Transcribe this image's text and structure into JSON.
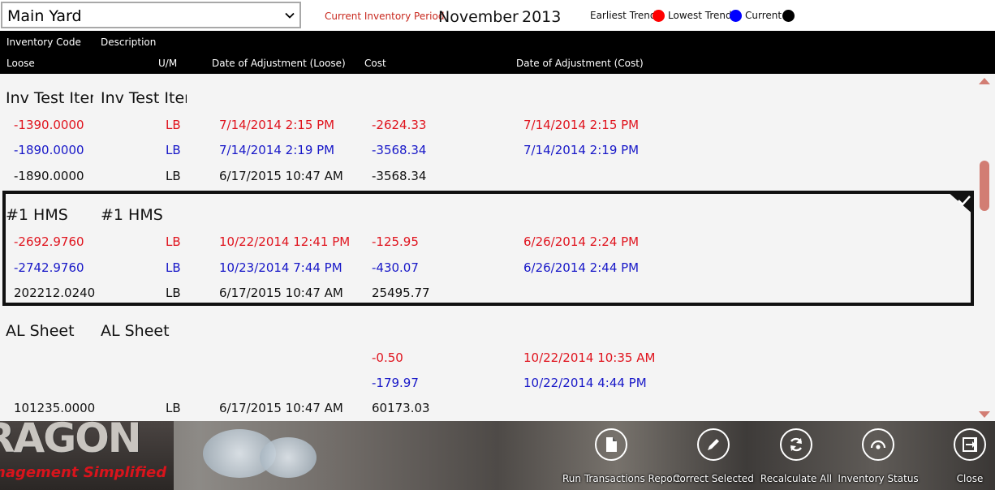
{
  "top": {
    "yard_selected": "Main Yard",
    "period_label": "Current Inventory Period",
    "period_month": "November",
    "period_year": "2013",
    "legend": [
      {
        "label": "Earliest Trend",
        "color": "#ff0000"
      },
      {
        "label": "Lowest Trend",
        "color": "#0000ff"
      },
      {
        "label": "Current",
        "color": "#000000"
      }
    ]
  },
  "header": {
    "inventory_code": "Inventory Code",
    "description": "Description",
    "loose": "Loose",
    "um": "U/M",
    "date_adj_loose": "Date of Adjustment (Loose)",
    "cost": "Cost",
    "date_adj_cost": "Date of Adjustment (Cost)"
  },
  "items": [
    {
      "code": "Inv Test Item",
      "description": "Inv Test Item",
      "earliest": {
        "loose": "-1390.0000",
        "um": "LB",
        "date_loose": "7/14/2014 2:15 PM",
        "cost": "-2624.33",
        "date_cost": "7/14/2014 2:15 PM"
      },
      "lowest": {
        "loose": "-1890.0000",
        "um": "LB",
        "date_loose": "7/14/2014 2:19 PM",
        "cost": "-3568.34",
        "date_cost": "7/14/2014 2:19 PM"
      },
      "current": {
        "loose": "-1890.0000",
        "um": "LB",
        "date_loose": "6/17/2015 10:47 AM",
        "cost": "-3568.34",
        "date_cost": ""
      }
    },
    {
      "code": "#1 HMS",
      "description": "#1 HMS",
      "earliest": {
        "loose": "-2692.9760",
        "um": "LB",
        "date_loose": "10/22/2014 12:41 PM",
        "cost": "-125.95",
        "date_cost": "6/26/2014 2:24 PM"
      },
      "lowest": {
        "loose": "-2742.9760",
        "um": "LB",
        "date_loose": "10/23/2014 7:44 PM",
        "cost": "-430.07",
        "date_cost": "6/26/2014 2:44 PM"
      },
      "current": {
        "loose": "202212.0240",
        "um": "LB",
        "date_loose": "6/17/2015 10:47 AM",
        "cost": "25495.77",
        "date_cost": ""
      }
    },
    {
      "code": "AL Sheet",
      "description": "AL Sheet",
      "earliest": {
        "loose": "",
        "um": "",
        "date_loose": "",
        "cost": "-0.50",
        "date_cost": "10/22/2014 10:35 AM"
      },
      "lowest": {
        "loose": "",
        "um": "",
        "date_loose": "",
        "cost": "-179.97",
        "date_cost": "10/22/2014 4:44 PM"
      },
      "current": {
        "loose": "101235.0000",
        "um": "LB",
        "date_loose": "6/17/2015 10:47 AM",
        "cost": "60173.03",
        "date_cost": ""
      }
    }
  ],
  "logo": {
    "main": "RAGON",
    "sub": "nagement Simplified"
  },
  "appbar": [
    {
      "label": "Run Transactions Report",
      "icon": "document-icon"
    },
    {
      "label": "Correct Selected",
      "icon": "pencil-icon"
    },
    {
      "label": "Recalculate All",
      "icon": "refresh-icon"
    },
    {
      "label": "Inventory Status",
      "icon": "gauge-icon"
    },
    {
      "label": "Close",
      "icon": "exit-icon"
    }
  ]
}
